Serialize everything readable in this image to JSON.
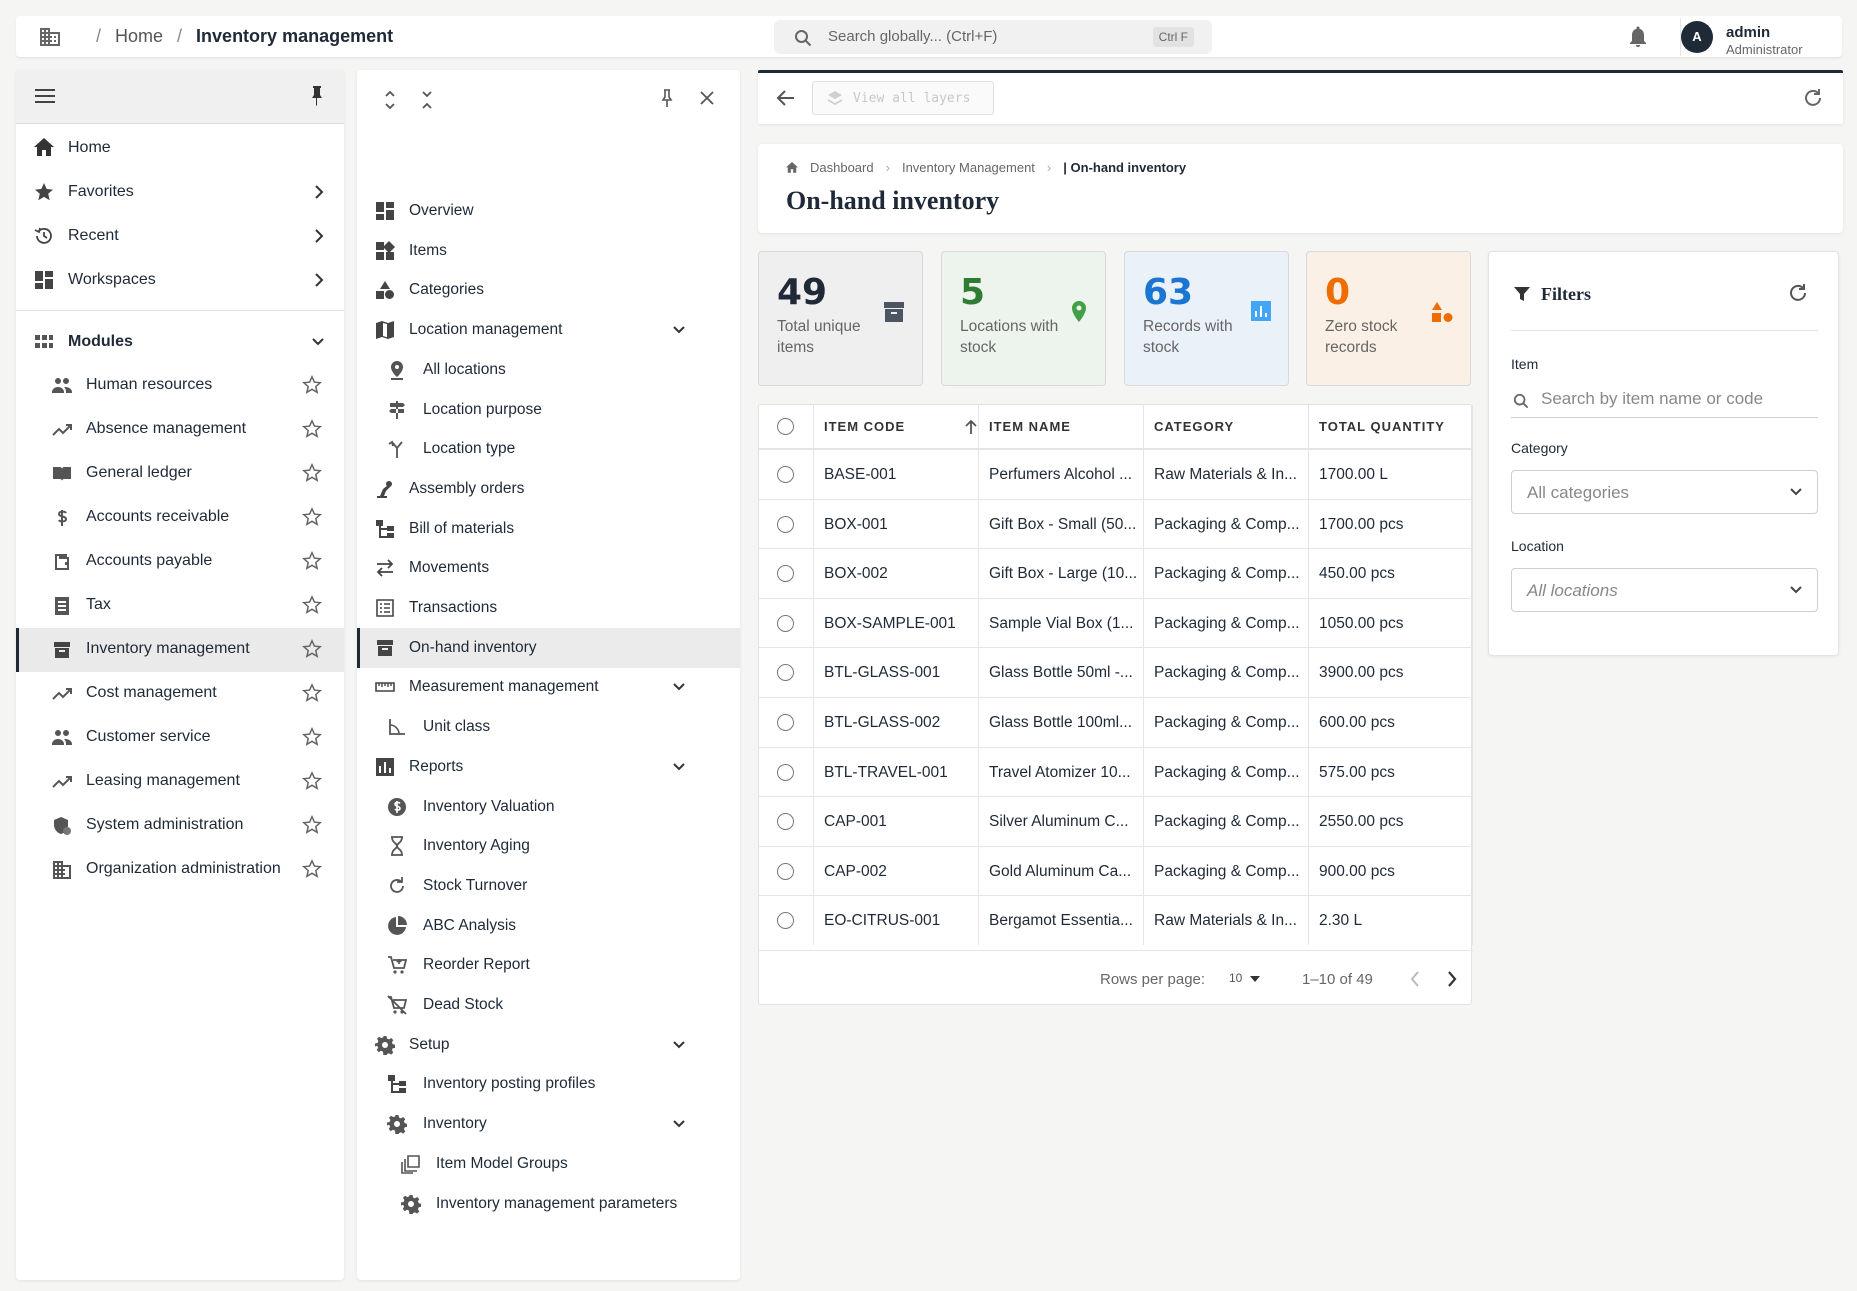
{
  "topbar": {
    "breadcrumb": [
      "Home",
      "Inventory management"
    ],
    "search_placeholder": "Search globally... (Ctrl+F)",
    "search_shortcut": "Ctrl F",
    "user": {
      "initial": "A",
      "name": "admin",
      "role": "Administrator"
    }
  },
  "left_nav": {
    "items": [
      {
        "label": "Home",
        "icon": "home-icon"
      },
      {
        "label": "Favorites",
        "icon": "star-filled-icon"
      },
      {
        "label": "Recent",
        "icon": "history-icon"
      },
      {
        "label": "Workspaces",
        "icon": "dashboard-icon"
      }
    ],
    "modules_label": "Modules",
    "modules": [
      {
        "label": "Human resources",
        "icon": "people-icon"
      },
      {
        "label": "Absence management",
        "icon": "trending-up-icon"
      },
      {
        "label": "General ledger",
        "icon": "book-icon"
      },
      {
        "label": "Accounts receivable",
        "icon": "dollar-icon"
      },
      {
        "label": "Accounts payable",
        "icon": "wallet-icon"
      },
      {
        "label": "Tax",
        "icon": "receipt-icon"
      },
      {
        "label": "Inventory management",
        "icon": "inventory-icon",
        "active": true
      },
      {
        "label": "Cost management",
        "icon": "trending-up-icon"
      },
      {
        "label": "Customer service",
        "icon": "people-icon"
      },
      {
        "label": "Leasing management",
        "icon": "trending-up-icon"
      },
      {
        "label": "System administration",
        "icon": "admin-shield-icon"
      },
      {
        "label": "Organization administration",
        "icon": "building-icon"
      }
    ]
  },
  "sub_nav": {
    "items": [
      {
        "label": "Overview",
        "icon": "dashboard-icon",
        "level": 0
      },
      {
        "label": "Items",
        "icon": "widgets-icon",
        "level": 0
      },
      {
        "label": "Categories",
        "icon": "category-icon",
        "level": 0
      },
      {
        "label": "Location management",
        "icon": "map-icon",
        "level": 0,
        "expandable": true
      },
      {
        "label": "All locations",
        "icon": "pin-icon",
        "level": 1
      },
      {
        "label": "Location purpose",
        "icon": "signpost-icon",
        "level": 1
      },
      {
        "label": "Location type",
        "icon": "merge-icon",
        "level": 1
      },
      {
        "label": "Assembly orders",
        "icon": "robot-arm-icon",
        "level": 0
      },
      {
        "label": "Bill of materials",
        "icon": "tree-icon",
        "level": 0
      },
      {
        "label": "Movements",
        "icon": "swap-icon",
        "level": 0
      },
      {
        "label": "Transactions",
        "icon": "list-icon",
        "level": 0
      },
      {
        "label": "On-hand inventory",
        "icon": "inventory-icon",
        "level": 0,
        "active": true
      },
      {
        "label": "Measurement management",
        "icon": "ruler-icon",
        "level": 0,
        "expandable": true
      },
      {
        "label": "Unit class",
        "icon": "angle-icon",
        "level": 1
      },
      {
        "label": "Reports",
        "icon": "bar-chart-icon",
        "level": 0,
        "expandable": true
      },
      {
        "label": "Inventory Valuation",
        "icon": "dollar-circle-icon",
        "level": 1
      },
      {
        "label": "Inventory Aging",
        "icon": "hourglass-icon",
        "level": 1
      },
      {
        "label": "Stock Turnover",
        "icon": "refresh-icon",
        "level": 1
      },
      {
        "label": "ABC Analysis",
        "icon": "pie-chart-icon",
        "level": 1
      },
      {
        "label": "Reorder Report",
        "icon": "cart-icon",
        "level": 1
      },
      {
        "label": "Dead Stock",
        "icon": "cart-off-icon",
        "level": 1
      },
      {
        "label": "Setup",
        "icon": "gear-icon",
        "level": 0,
        "expandable": true
      },
      {
        "label": "Inventory posting profiles",
        "icon": "tree-icon",
        "level": 1
      },
      {
        "label": "Inventory",
        "icon": "gear-icon",
        "level": 1,
        "expandable": true
      },
      {
        "label": "Item Model Groups",
        "icon": "layers-icon",
        "level": 2
      },
      {
        "label": "Inventory management parameters",
        "icon": "gear-icon",
        "level": 2
      }
    ]
  },
  "toolbar": {
    "layers_label": "View all layers"
  },
  "page": {
    "crumbs": [
      "Dashboard",
      "Inventory Management",
      "On-hand inventory"
    ],
    "title": "On-hand inventory"
  },
  "stats": [
    {
      "value": "49",
      "label": "Total unique items",
      "color": "#1f2937",
      "bg": "#efefef",
      "icon": "archive-icon",
      "icon_color": "#4b5563"
    },
    {
      "value": "5",
      "label": "Locations with stock",
      "color": "#2e7d32",
      "bg": "#edf4ee",
      "icon": "location-pin-icon",
      "icon_color": "#43a047"
    },
    {
      "value": "63",
      "label": "Records with stock",
      "color": "#1976d2",
      "bg": "#eaf1f8",
      "icon": "chart-box-icon",
      "icon_color": "#42a5f5"
    },
    {
      "value": "0",
      "label": "Zero stock records",
      "color": "#ef6c00",
      "bg": "#fbf0e6",
      "icon": "shapes-icon",
      "icon_color": "#ef6c00"
    }
  ],
  "table": {
    "columns": [
      "ITEM CODE",
      "ITEM NAME",
      "CATEGORY",
      "TOTAL QUANTITY"
    ],
    "rows": [
      [
        "BASE-001",
        "Perfumers Alcohol ...",
        "Raw Materials & In...",
        "1700.00 L"
      ],
      [
        "BOX-001",
        "Gift Box - Small (50...",
        "Packaging & Comp...",
        "1700.00 pcs"
      ],
      [
        "BOX-002",
        "Gift Box - Large (10...",
        "Packaging & Comp...",
        "450.00 pcs"
      ],
      [
        "BOX-SAMPLE-001",
        "Sample Vial Box (1...",
        "Packaging & Comp...",
        "1050.00 pcs"
      ],
      [
        "BTL-GLASS-001",
        "Glass Bottle 50ml -...",
        "Packaging & Comp...",
        "3900.00 pcs"
      ],
      [
        "BTL-GLASS-002",
        "Glass Bottle 100ml...",
        "Packaging & Comp...",
        "600.00 pcs"
      ],
      [
        "BTL-TRAVEL-001",
        "Travel Atomizer 10...",
        "Packaging & Comp...",
        "575.00 pcs"
      ],
      [
        "CAP-001",
        "Silver Aluminum C...",
        "Packaging & Comp...",
        "2550.00 pcs"
      ],
      [
        "CAP-002",
        "Gold Aluminum Ca...",
        "Packaging & Comp...",
        "900.00 pcs"
      ],
      [
        "EO-CITRUS-001",
        "Bergamot Essentia...",
        "Raw Materials & In...",
        "2.30 L"
      ]
    ],
    "rows_per_page_label": "Rows per page:",
    "rows_per_page": "10",
    "range": "1–10 of 49"
  },
  "filters": {
    "title": "Filters",
    "item_label": "Item",
    "item_placeholder": "Search by item name or code",
    "category_label": "Category",
    "category_value": "All categories",
    "location_label": "Location",
    "location_value": "All locations"
  }
}
